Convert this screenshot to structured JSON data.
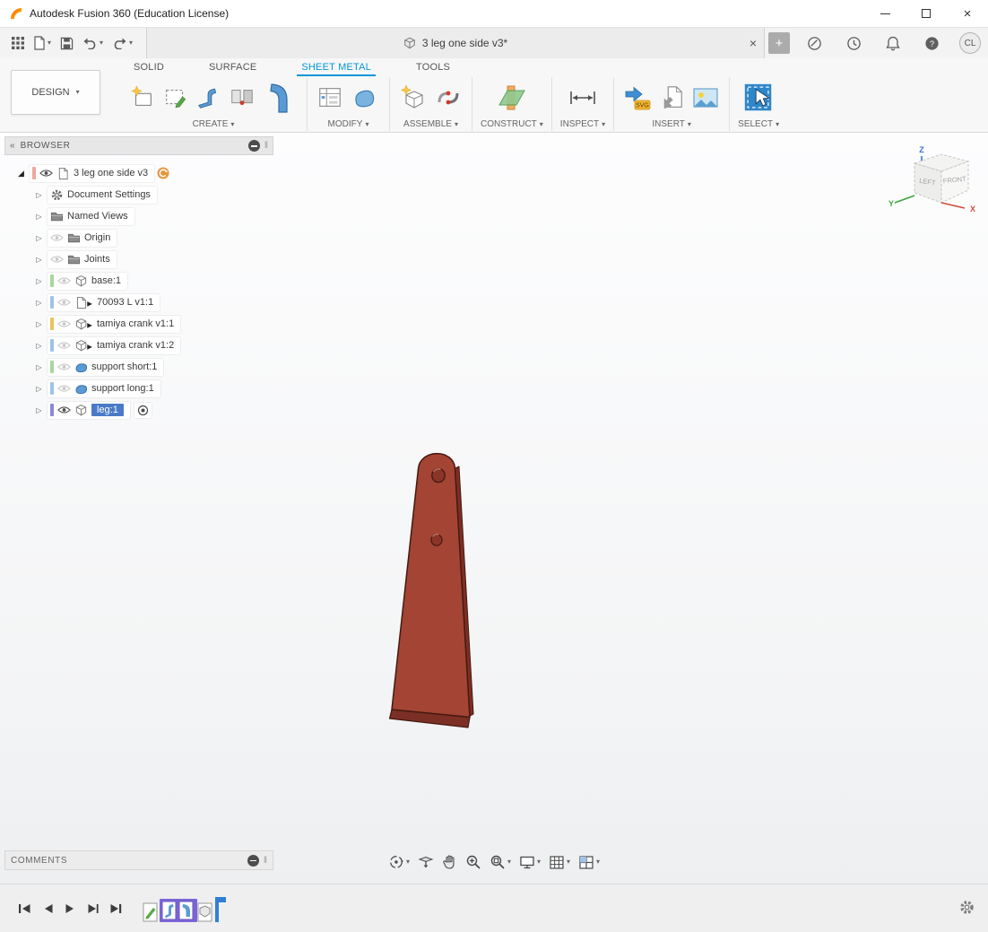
{
  "title_bar": {
    "app_title": "Autodesk Fusion 360 (Education License)"
  },
  "appbar": {
    "document_tab": "3 leg one side v3*",
    "avatar_initials": "CL"
  },
  "ribbon": {
    "workspace": "DESIGN",
    "tabs": [
      {
        "label": "SOLID",
        "active": false
      },
      {
        "label": "SURFACE",
        "active": false
      },
      {
        "label": "SHEET METAL",
        "active": true
      },
      {
        "label": "TOOLS",
        "active": false
      }
    ],
    "groups": [
      {
        "label": "CREATE"
      },
      {
        "label": "MODIFY"
      },
      {
        "label": "ASSEMBLE"
      },
      {
        "label": "CONSTRUCT"
      },
      {
        "label": "INSPECT"
      },
      {
        "label": "INSERT"
      },
      {
        "label": "SELECT"
      }
    ],
    "insert_svg_label": "SVG"
  },
  "browser": {
    "header": "BROWSER",
    "root": {
      "label": "3 leg one side v3",
      "swatch": "#f2a6a0",
      "eye": "visible"
    },
    "items": [
      {
        "label": "Document Settings",
        "icon": "gear-icon"
      },
      {
        "label": "Named Views",
        "icon": "folder-icon"
      },
      {
        "label": "Origin",
        "icon": "folder-icon",
        "eye": "hidden"
      },
      {
        "label": "Joints",
        "icon": "folder-icon",
        "eye": "hidden"
      },
      {
        "label": "base:1",
        "icon": "component-icon",
        "eye": "hidden",
        "swatch": "#a9d79e"
      },
      {
        "label": "70093 L v1:1",
        "icon": "linked-document-icon",
        "eye": "hidden",
        "swatch": "#9fc3e8"
      },
      {
        "label": "tamiya crank v1:1",
        "icon": "linked-component-icon",
        "eye": "hidden",
        "swatch": "#ecc25a"
      },
      {
        "label": "tamiya crank v1:2",
        "icon": "linked-component-icon",
        "eye": "hidden",
        "swatch": "#9fc3e8"
      },
      {
        "label": "support short:1",
        "icon": "body-icon",
        "eye": "hidden",
        "swatch": "#a9d79e"
      },
      {
        "label": "support long:1",
        "icon": "body-icon",
        "eye": "hidden",
        "swatch": "#9fc3e8"
      },
      {
        "label": "leg:1",
        "icon": "component-icon",
        "eye": "visible",
        "swatch": "#8a8ad8",
        "selected": true
      }
    ]
  },
  "viewcube": {
    "face_left": "LEFT",
    "face_front": "FRONT",
    "axis_x": "X",
    "axis_y": "Y",
    "axis_z": "Z"
  },
  "comments": {
    "label": "COMMENTS"
  },
  "icons": {
    "caret_down": "▾",
    "chevron_collapsed": "▷",
    "chevron_expanded": "◢",
    "double_chevron_left": "«",
    "grip": "‖",
    "close": "×",
    "plus": "+",
    "question": "?"
  },
  "theme": {
    "accent_blue": "#0696d7",
    "selection_blue": "#4a7bc8",
    "timeline_highlight": "#7b64d9",
    "part_face": "#a34434",
    "part_side": "#7c2f24",
    "part_outline": "#451911"
  }
}
